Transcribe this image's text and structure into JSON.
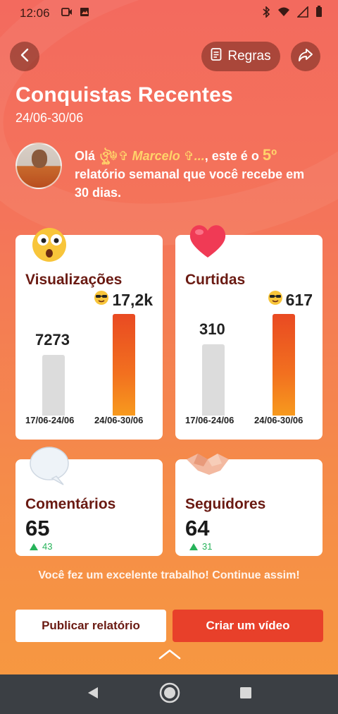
{
  "status_bar": {
    "time": "12:06"
  },
  "header": {
    "rules_label": "Regras",
    "title": "Conquistas Recentes",
    "date_range": "24/06-30/06"
  },
  "greeting": {
    "prefix": "Olá ",
    "username": "ঔৣ☬✞ Marcelo ✞...",
    "middle": ", este é o ",
    "ordinal": "5º",
    "suffix": " relatório semanal que você recebe em 30 dias."
  },
  "stats": {
    "views": {
      "title": "Visualizações",
      "current_value": "17,2k",
      "previous_value": "7273",
      "previous_period": "17/06-24/06",
      "current_period": "24/06-30/06",
      "current_fraction": 1.0,
      "previous_fraction": 0.6
    },
    "likes": {
      "title": "Curtidas",
      "current_value": "617",
      "previous_value": "310",
      "previous_period": "17/06-24/06",
      "current_period": "24/06-30/06",
      "current_fraction": 1.0,
      "previous_fraction": 0.7
    },
    "comments": {
      "title": "Comentários",
      "value": "65",
      "delta": "43"
    },
    "followers": {
      "title": "Seguidores",
      "value": "64",
      "delta": "31"
    }
  },
  "cheer_text": "Você fez um excelente trabalho! Continue assim!",
  "actions": {
    "publish_label": "Publicar relatório",
    "create_label": "Criar um vídeo"
  },
  "colors": {
    "accent": "#e8402a",
    "title_dark": "#6a1a12",
    "positive": "#27b35a",
    "highlight": "#ffd36a"
  }
}
